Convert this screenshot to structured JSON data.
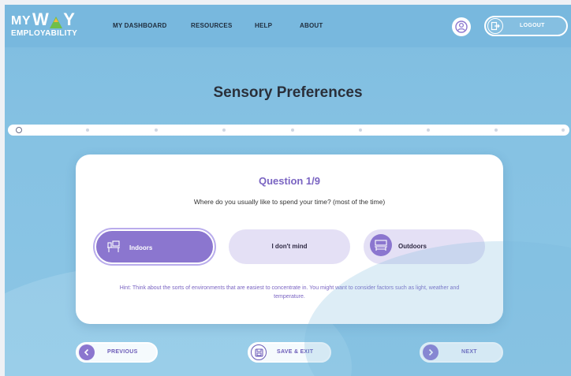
{
  "header": {
    "logo_line1_my": "MY",
    "logo_line1_way": "W Y",
    "logo_line2": "EMPLOYABILITY",
    "nav": [
      "MY DASHBOARD",
      "RESOURCES",
      "HELP",
      "ABOUT"
    ],
    "logout_label": "LOGOUT"
  },
  "page": {
    "title": "Sensory Preferences"
  },
  "progress": {
    "total_steps": 9,
    "current_step": 1
  },
  "question": {
    "number_label": "Question 1/9",
    "text": "Where do you usually like to spend your time? (most of the time)",
    "options": [
      {
        "label": "Indoors",
        "icon": "indoors-desk-icon",
        "selected": true
      },
      {
        "label": "I don't mind",
        "icon": "",
        "selected": false
      },
      {
        "label": "Outdoors",
        "icon": "outdoors-bench-icon",
        "selected": false
      }
    ],
    "hint": "Hint: Think about the sorts of environments that are easiest to concentrate in. You might want to consider factors such as light, weather and temperature."
  },
  "footer": {
    "previous_label": "PREVIOUS",
    "save_exit_label": "SAVE & EXIT",
    "next_label": "NEXT"
  },
  "colors": {
    "accent": "#7a64c2",
    "selected_option": "#8b76cf",
    "option_bg": "#e4e0f5",
    "header_bg": "#78b8de"
  }
}
